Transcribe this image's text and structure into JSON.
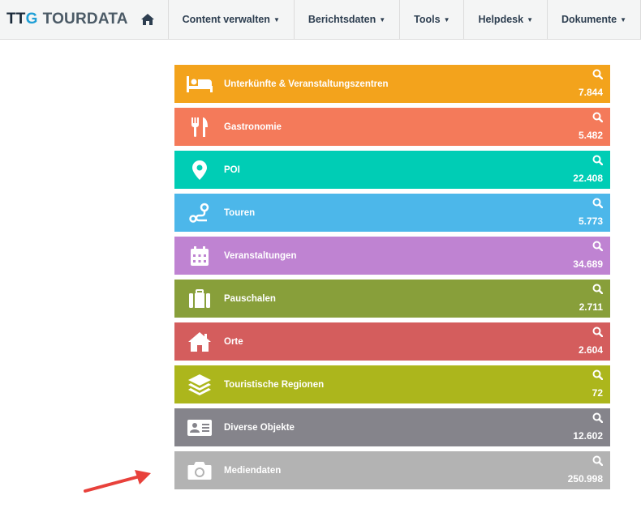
{
  "brand": {
    "ttg": "TT",
    "g": "G",
    "tourdata": "TOURDATA"
  },
  "nav": {
    "items": [
      {
        "label": "Content verwalten"
      },
      {
        "label": "Berichtsdaten"
      },
      {
        "label": "Tools"
      },
      {
        "label": "Helpdesk"
      },
      {
        "label": "Dokumente"
      }
    ]
  },
  "tiles": [
    {
      "label": "Unterkünfte & Veranstaltungszentren",
      "count": "7.844",
      "color": "#f3a31c",
      "icon": "bed-icon"
    },
    {
      "label": "Gastronomie",
      "count": "5.482",
      "color": "#f47a5a",
      "icon": "cutlery-icon"
    },
    {
      "label": "POI",
      "count": "22.408",
      "color": "#00cdb5",
      "icon": "map-marker-icon"
    },
    {
      "label": "Touren",
      "count": "5.773",
      "color": "#4cb7ea",
      "icon": "route-icon"
    },
    {
      "label": "Veranstaltungen",
      "count": "34.689",
      "color": "#bf83d2",
      "icon": "calendar-icon"
    },
    {
      "label": "Pauschalen",
      "count": "2.711",
      "color": "#889f3a",
      "icon": "suitcase-icon"
    },
    {
      "label": "Orte",
      "count": "2.604",
      "color": "#d45d5d",
      "icon": "house-icon"
    },
    {
      "label": "Touristische Regionen",
      "count": "72",
      "color": "#acb61c",
      "icon": "layers-icon"
    },
    {
      "label": "Diverse Objekte",
      "count": "12.602",
      "color": "#85848b",
      "icon": "id-card-icon"
    },
    {
      "label": "Mediendaten",
      "count": "250.998",
      "color": "#b3b3b3",
      "icon": "camera-icon"
    }
  ]
}
